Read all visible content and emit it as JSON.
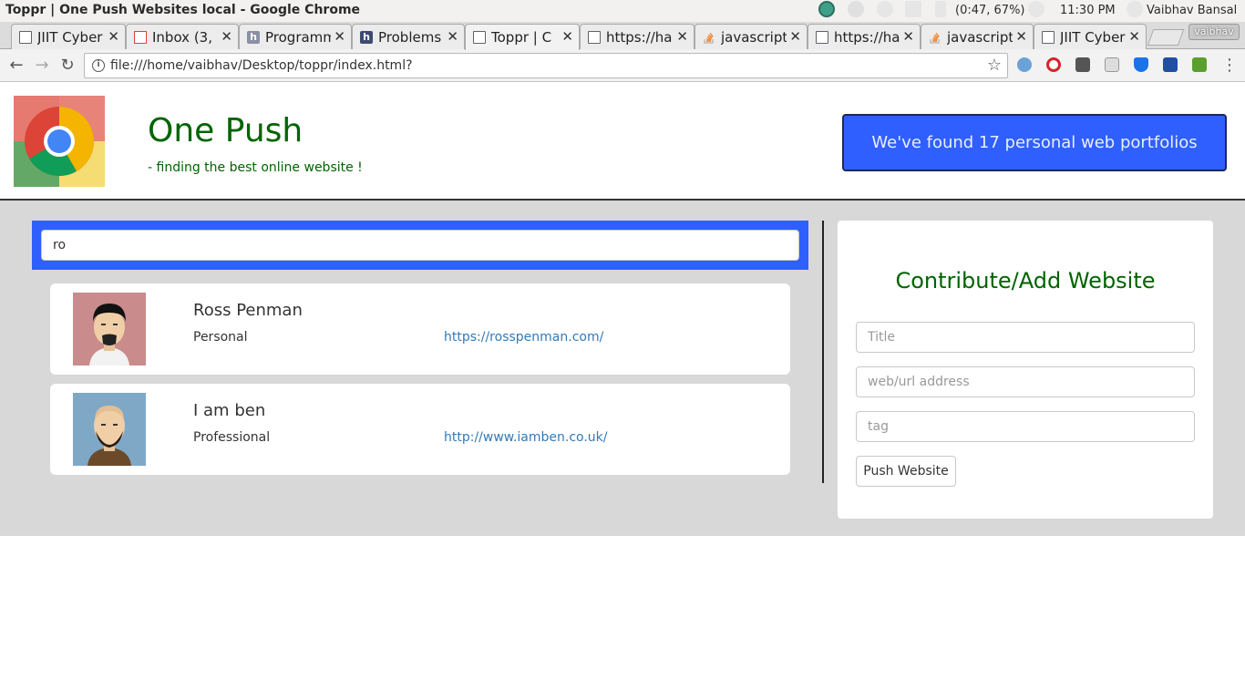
{
  "os": {
    "window_title": "Toppr | One Push Websites local - Google Chrome",
    "battery": "(0:47, 67%)",
    "clock": "11:30 PM",
    "user": "Vaibhav Bansal"
  },
  "browser": {
    "tabs": [
      {
        "label": "JIIT Cyber",
        "icon": "doc-icon"
      },
      {
        "label": "Inbox (3,",
        "icon": "gmail-icon"
      },
      {
        "label": "Programm",
        "icon": "h-icon"
      },
      {
        "label": "Problems",
        "icon": "h-icon"
      },
      {
        "label": "Toppr | C",
        "icon": "doc-icon"
      },
      {
        "label": "https://ha",
        "icon": "doc-icon"
      },
      {
        "label": "javascript",
        "icon": "stackoverflow-icon"
      },
      {
        "label": "https://ha",
        "icon": "doc-icon"
      },
      {
        "label": "javascript",
        "icon": "stackoverflow-icon"
      },
      {
        "label": "JIIT Cyber",
        "icon": "doc-icon"
      }
    ],
    "active_tab": 4,
    "close_glyph": "✕",
    "profile": "vaibhav",
    "url": "file:///home/vaibhav/Desktop/toppr/index.html?"
  },
  "site": {
    "title": "One Push",
    "tagline": "- finding the best online website !",
    "found_button": "We've found 17 personal web portfolios",
    "search_value": "ro",
    "results": [
      {
        "name": "Ross Penman",
        "tag": "Personal",
        "url": "https://rosspenman.com/"
      },
      {
        "name": "I am ben",
        "tag": "Professional",
        "url": "http://www.iamben.co.uk/"
      }
    ],
    "contribute": {
      "title": "Contribute/Add Website",
      "title_placeholder": "Title",
      "url_placeholder": "web/url address",
      "tag_placeholder": "tag",
      "submit_label": "Push Website"
    }
  },
  "colors": {
    "brand_green": "#006400",
    "accent_blue": "#2f5fff",
    "link_blue": "#337ab7",
    "content_bg": "#d8d8d8"
  }
}
